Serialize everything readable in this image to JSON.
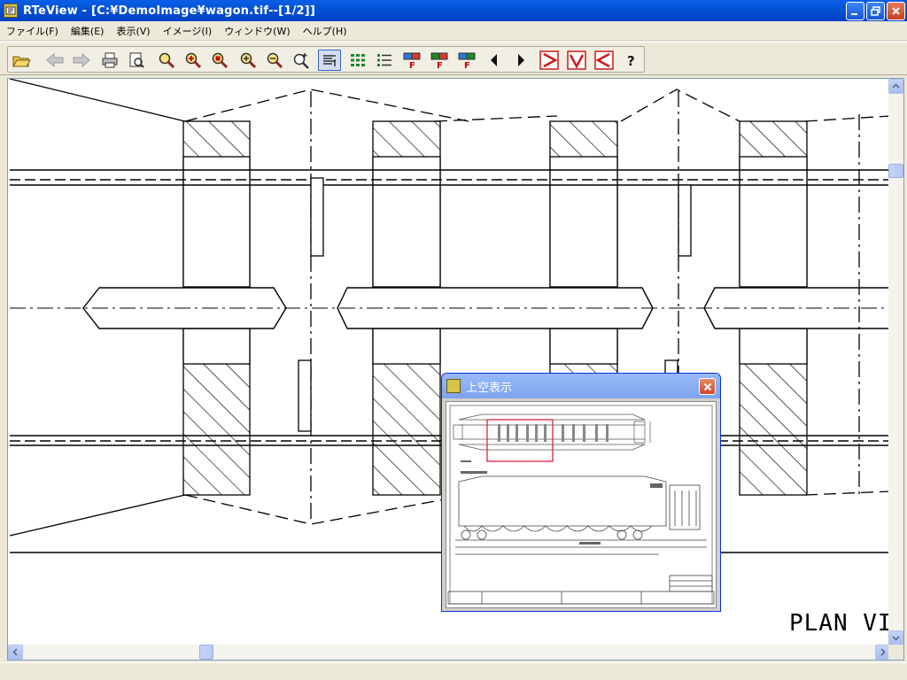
{
  "window": {
    "title": "RTeView - [C:¥DemoImage¥wagon.tif--[1/2]]"
  },
  "menu": {
    "items": [
      {
        "label": "ファイル(F)"
      },
      {
        "label": "編集(E)"
      },
      {
        "label": "表示(V)"
      },
      {
        "label": "イメージ(I)"
      },
      {
        "label": "ウィンドウ(W)"
      },
      {
        "label": "ヘルプ(H)"
      }
    ]
  },
  "toolbar": {
    "icons": [
      "open-folder-icon",
      "back-arrow-icon",
      "forward-arrow-icon",
      "print-icon",
      "print-preview-icon",
      "zoom-area-icon",
      "zoom-in-icon",
      "zoom-fit-icon",
      "zoom-plus-icon",
      "zoom-minus-icon",
      "zoom-actual-icon",
      "view-list-icon",
      "view-grid-icon",
      "view-detail-icon",
      "layer-f1-icon",
      "layer-f2-icon",
      "layer-f3-icon",
      "prev-page-icon",
      "next-page-icon",
      "rotate-right-icon",
      "rotate-down-icon",
      "rotate-left-icon",
      "help-icon"
    ]
  },
  "drawing": {
    "label": "PLAN VI"
  },
  "overview": {
    "title": "上空表示"
  },
  "colors": {
    "titlebar": "#0453d6",
    "overview_titlebar": "#7ea4ef",
    "viewport_rect": "#e0203a"
  }
}
